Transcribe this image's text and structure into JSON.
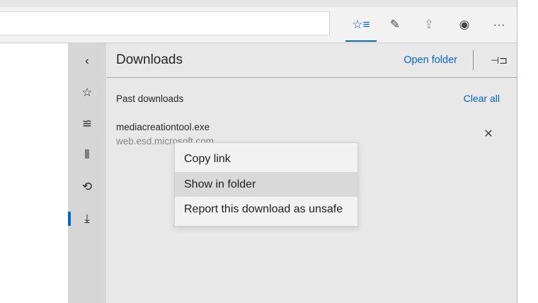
{
  "toolbar": {
    "address_value": "",
    "buttons": [
      {
        "name": "favorites-hub-icon",
        "glyph": "☆≡"
      },
      {
        "name": "pen-icon",
        "glyph": "✎"
      },
      {
        "name": "share-icon",
        "glyph": "⇪"
      },
      {
        "name": "extension-icon",
        "glyph": "◉"
      },
      {
        "name": "more-icon",
        "glyph": "···"
      }
    ]
  },
  "hub_rail": {
    "items": [
      {
        "name": "collapse",
        "glyph": "‹"
      },
      {
        "name": "favorites",
        "glyph": "☆"
      },
      {
        "name": "reading-list",
        "glyph": "≌"
      },
      {
        "name": "books",
        "glyph": "⫴"
      },
      {
        "name": "history",
        "glyph": "⟲"
      },
      {
        "name": "downloads",
        "glyph": "⤓"
      }
    ]
  },
  "pane": {
    "title": "Downloads",
    "open_folder": "Open folder",
    "pin_glyph": "⊣⊐",
    "section_title": "Past downloads",
    "clear_all": "Clear all",
    "download": {
      "file": "mediacreationtool.exe",
      "source": "web.esd.microsoft.com",
      "remove_glyph": "✕"
    }
  },
  "context_menu": {
    "items": [
      "Copy link",
      "Show in folder",
      "Report this download as unsafe"
    ],
    "hovered_index": 1
  },
  "colors": {
    "accent": "#0a64c8"
  }
}
